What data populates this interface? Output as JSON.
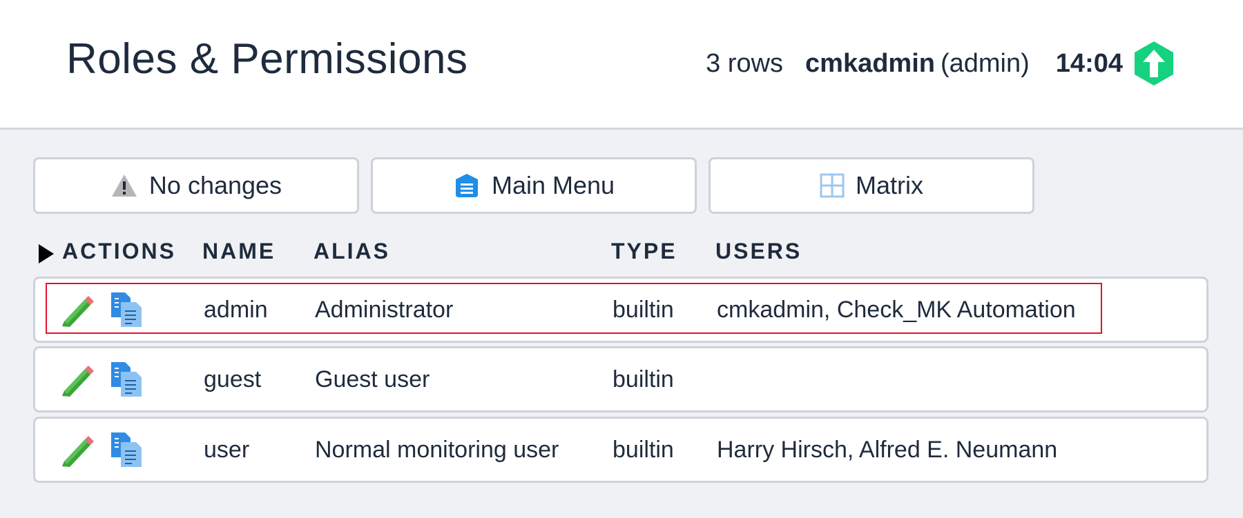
{
  "header": {
    "title": "Roles & Permissions",
    "rows_count": "3 rows",
    "user_name": "cmkadmin",
    "user_role": "(admin)",
    "clock": "14:04",
    "logo_color": "#15d180"
  },
  "toolbar": {
    "changes_label": "No changes",
    "main_menu_label": "Main Menu",
    "matrix_label": "Matrix"
  },
  "table": {
    "columns": [
      "ACTIONS",
      "NAME",
      "ALIAS",
      "TYPE",
      "USERS"
    ],
    "rows": [
      {
        "name": "admin",
        "alias": "Administrator",
        "type": "builtin",
        "users": "cmkadmin, Check_MK Automation"
      },
      {
        "name": "guest",
        "alias": "Guest user",
        "type": "builtin",
        "users": ""
      },
      {
        "name": "user",
        "alias": "Normal monitoring user",
        "type": "builtin",
        "users": "Harry Hirsch, Alfred E. Neumann"
      }
    ]
  },
  "colors": {
    "accent_blue": "#1f8ee8",
    "edit_green": "#3aa636",
    "highlight_red": "#e0132b"
  }
}
